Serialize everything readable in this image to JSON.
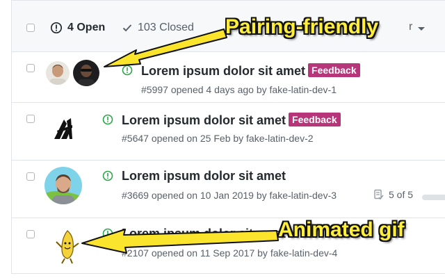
{
  "header": {
    "open_label": "4 Open",
    "closed_label": "103 Closed",
    "sort_partial": "r"
  },
  "issues": [
    {
      "title": "Lorem ipsum dolor sit amet",
      "label": "Feedback",
      "meta": "#5997 opened 4 days ago by fake-latin-dev-1",
      "avatars": [
        "avatar-person-light",
        "avatar-person-dark"
      ]
    },
    {
      "title": "Lorem ipsum dolor sit amet",
      "label": "Feedback",
      "meta": "#5647 opened on 25 Feb by fake-latin-dev-2",
      "avatars": [
        "avatar-logo-black"
      ]
    },
    {
      "title": "Lorem ipsum dolor sit amet",
      "label": "",
      "meta": "#3669 opened on 10 Jan 2019 by fake-latin-dev-3",
      "tasks": "5 of 5",
      "tasks_done_fraction": 1.0,
      "avatars": [
        "avatar-person-green"
      ]
    },
    {
      "title": "Lorem ipsum dolor sit amet",
      "label": "",
      "meta": "#2107 opened on 11 Sep 2017 by fake-latin-dev-4",
      "avatars": [
        "avatar-dancing-banana"
      ]
    }
  ],
  "callouts": {
    "top": "Pairing-friendly",
    "bottom": "Animated gif"
  },
  "colors": {
    "callout_fill": "#ffef3a",
    "feedback_label": "#b7367a",
    "open_green": "#28a745",
    "header_bg": "#f6f8fa"
  }
}
